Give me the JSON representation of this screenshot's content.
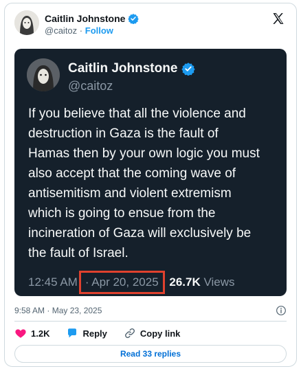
{
  "author": {
    "name": "Caitlin Johnstone",
    "handle": "@caitoz",
    "separator": "·",
    "follow_label": "Follow"
  },
  "screenshot": {
    "name": "Caitlin Johnstone",
    "handle": "@caitoz",
    "text_lines": [
      "If you believe that all the violence and",
      "destruction in Gaza is the fault of",
      "Hamas then by your own logic you must",
      "also accept that the coming wave of",
      "antisemitism and violent extremism",
      "which is going to ensue from the",
      "incineration of Gaza will exclusively be",
      "the fault of Israel."
    ],
    "time": "12:45 AM",
    "dot": "·",
    "date": "Apr 20, 2025",
    "views_count": "26.7K",
    "views_label": "Views",
    "highlight_color": "#e0412e"
  },
  "post": {
    "timestamp": "9:58 AM · May 23, 2025",
    "likes": "1.2K",
    "reply_label": "Reply",
    "copy_link_label": "Copy link",
    "read_replies_label": "Read 33 replies"
  },
  "colors": {
    "accent": "#1d9bf0",
    "like": "#f91880",
    "dark_bg": "#15202b"
  },
  "icons": {
    "verified": "verified-badge-icon",
    "x_logo": "x-logo-icon",
    "info": "info-icon",
    "like": "heart-icon",
    "reply": "reply-bubble-icon",
    "copy": "link-icon"
  }
}
